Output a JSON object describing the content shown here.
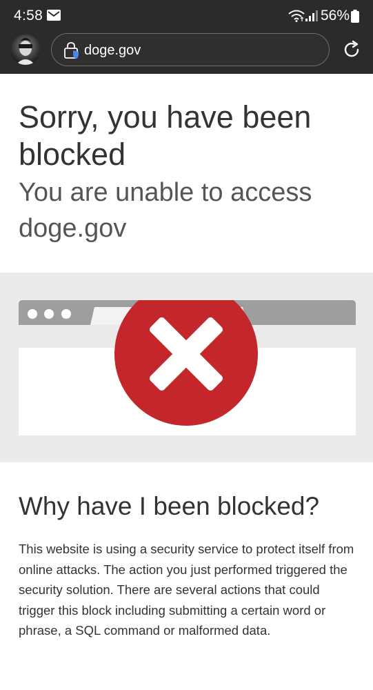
{
  "status_bar": {
    "time": "4:58",
    "battery": "56%",
    "icons": [
      "mail-icon",
      "wifi-icon",
      "signal-icon",
      "battery-icon"
    ]
  },
  "browser": {
    "url": "doge.gov",
    "icons": [
      "avatar",
      "lock-icon",
      "reload-icon"
    ]
  },
  "page": {
    "headline": "Sorry, you have been blocked",
    "subheadline": "You are unable to access doge.gov",
    "why_heading": "Why have I been blocked?",
    "why_body": "This website is using a security service to protect itself from online attacks. The action you just performed triggered the security solution. There are several actions that could trigger this block including submitting a certain word or phrase, a SQL command or malformed data."
  },
  "colors": {
    "status_bg": "#2b2b2b",
    "illustration_bg": "#ebebeb",
    "error_red": "#c3272b",
    "browser_gray": "#9e9e9e"
  }
}
